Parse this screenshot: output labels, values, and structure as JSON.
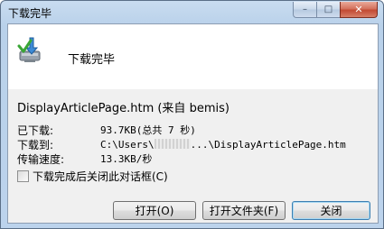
{
  "window": {
    "title": "下载完毕",
    "caption_min": "–",
    "caption_max": "□",
    "caption_close": "✕"
  },
  "header": {
    "heading": "下载完毕",
    "icon": "download-complete-icon"
  },
  "file": {
    "name": "DisplayArticlePage.htm (来自 bemis)"
  },
  "details": {
    "downloaded_label": "已下载:",
    "downloaded_value": "93.7KB(总共 7 秒)",
    "saved_to_label": "下载到:",
    "saved_to_prefix": "C:\\Users\\",
    "saved_to_suffix": "...\\DisplayArticlePage.htm",
    "speed_label": "传输速度:",
    "speed_value": "13.3KB/秒"
  },
  "options": {
    "close_on_complete_label": "下载完成后关闭此对话框(C)",
    "close_on_complete_checked": false
  },
  "buttons": {
    "open": "打开(O)",
    "open_folder": "打开文件夹(F)",
    "close": "关闭"
  }
}
